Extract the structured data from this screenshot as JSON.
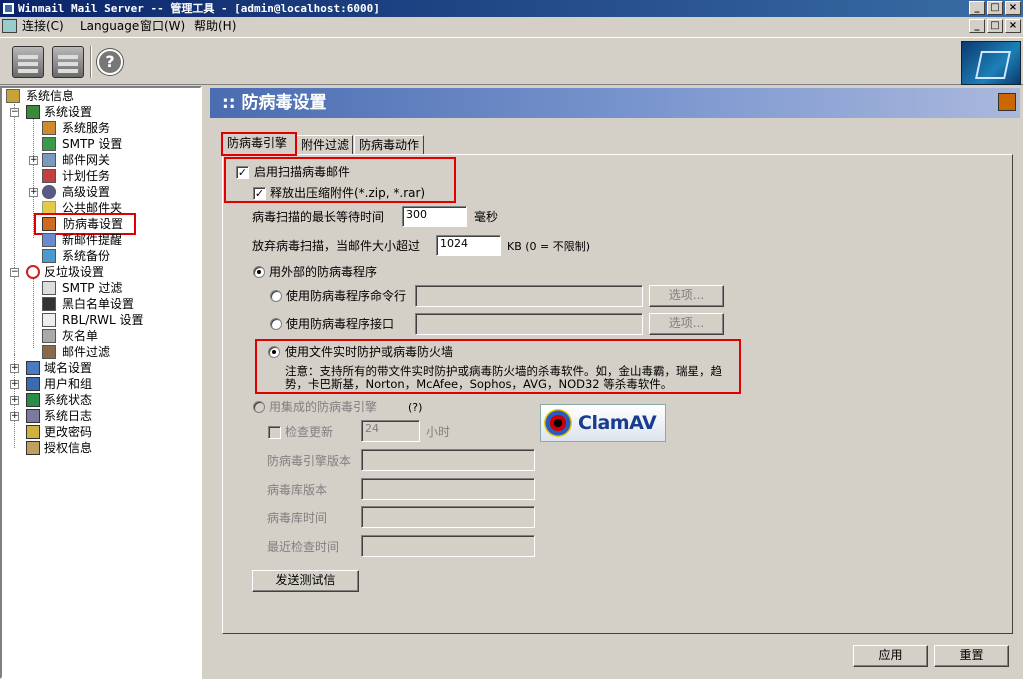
{
  "window": {
    "title": "Winmail Mail Server -- 管理工具 - [admin@localhost:6000]",
    "controls": [
      "_",
      "□",
      "×"
    ]
  },
  "menu": [
    "连接(C)",
    "Language",
    "窗口(W)",
    "帮助(H)"
  ],
  "toolbar": {
    "help_glyph": "?"
  },
  "tree": {
    "root": "系统信息",
    "system_settings": "系统设置",
    "system_service": "系统服务",
    "smtp_settings": "SMTP 设置",
    "mail_gateway": "邮件网关",
    "scheduled_tasks": "计划任务",
    "advanced_settings": "高级设置",
    "public_folder": "公共邮件夹",
    "antivirus_settings": "防病毒设置",
    "new_mail_notify": "新邮件提醒",
    "system_backup": "系统备份",
    "antispam_settings": "反垃圾设置",
    "smtp_filter": "SMTP 过滤",
    "blackwhite_list": "黑白名单设置",
    "rbl_settings": "RBL/RWL 设置",
    "greylist": "灰名单",
    "mail_filter": "邮件过滤",
    "domain_settings": "域名设置",
    "users_groups": "用户和组",
    "system_status": "系统状态",
    "system_log": "系统日志",
    "change_password": "更改密码",
    "license_info": "授权信息"
  },
  "panel": {
    "title": ":: 防病毒设置"
  },
  "tabs": [
    "防病毒引擎",
    "附件过滤",
    "防病毒动作"
  ],
  "form": {
    "enable_scan": "启用扫描病毒邮件",
    "release_compressed": "释放出压缩附件(*.zip, *.rar)",
    "max_wait_label": "病毒扫描的最长等待时间",
    "max_wait_value": "300",
    "max_wait_unit": "毫秒",
    "skip_size_label": "放弃病毒扫描，当邮件大小超过",
    "skip_size_value": "1024",
    "skip_size_unit": "KB (0 = 不限制)",
    "use_external": "用外部的防病毒程序",
    "use_cmdline": "使用防病毒程序命令行",
    "use_interface": "使用防病毒程序接口",
    "options_btn": "选项...",
    "use_realtime": "使用文件实时防护或病毒防火墙",
    "note": "注意：支持所有的带文件实时防护或病毒防火墙的杀毒软件。如，金山毒霸，瑞星，趋势，卡巴斯基，Norton，McAfee，Sophos，AVG，NOD32 等杀毒软件。",
    "use_builtin": "用集成的防病毒引擎",
    "builtin_help": "(?)",
    "check_update": "检查更新",
    "update_hours_value": "24",
    "update_hours_unit": "小时",
    "engine_version": "防病毒引擎版本",
    "db_version": "病毒库版本",
    "db_time": "病毒库时间",
    "last_check": "最近检查时间",
    "send_test": "发送测试信",
    "clamav_logo": "ClamAV"
  },
  "footer": {
    "apply": "应用",
    "reset": "重置"
  }
}
